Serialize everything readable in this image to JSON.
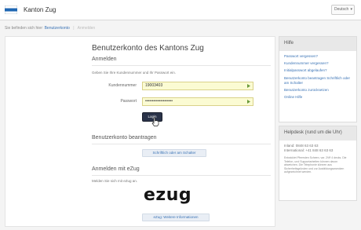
{
  "header": {
    "site_name": "Kanton Zug",
    "language": "Deutsch"
  },
  "breadcrumb": {
    "prefix": "Sie befinden sich hier:",
    "link": "Benutzerkonto",
    "current": "Anmelden"
  },
  "main": {
    "title": "Benutzerkonto des Kantons Zug",
    "login": {
      "heading": "Anmelden",
      "intro": "Geben Sie Ihre Kundennummer und Ihr Passwort ein.",
      "customer_label": "Kundennummer",
      "customer_value": "19003403",
      "password_label": "Passwort",
      "password_value": "••••••••••••••••••••",
      "button": "Login"
    },
    "apply": {
      "heading": "Benutzerkonto beantragen",
      "button": "Schriftlich oder am Schalter"
    },
    "ezug": {
      "heading": "Anmelden mit eZug",
      "intro": "Melden Sie sich mit eZug an.",
      "logo_text": "ezug",
      "button": "eZug: Weitere Informationen"
    }
  },
  "sidebar": {
    "help": {
      "heading": "Hilfe",
      "links": [
        "Passwort vergessen?",
        "Kundennummer vergessen?",
        "Initialpasswort abgelaufen?",
        "Benutzerkonto beantragen Schriftlich oder am Schalter",
        "Benutzerkonto zurücksetzen",
        "Online Hilfe"
      ]
    },
    "helpdesk": {
      "heading": "Helpdesk (rund um die Uhr)",
      "phone_ch": "Inland: 0848 63 63 63",
      "phone_intl": "International: +41 848 63 63 63",
      "fine_print": "Entwicklet Pfeersten Scheen, var. 2Vff 4 decks. Die Telefon- und Supportarbeiten können davon abweichen. Die Telephonie können aus Sicherheitsgründen und zur Ausbildungszwecken aufgezeichnet werden."
    }
  },
  "colors": {
    "accent": "#3a73b5",
    "login_button": "#2a3349",
    "field_bg": "#fbfbd3"
  }
}
